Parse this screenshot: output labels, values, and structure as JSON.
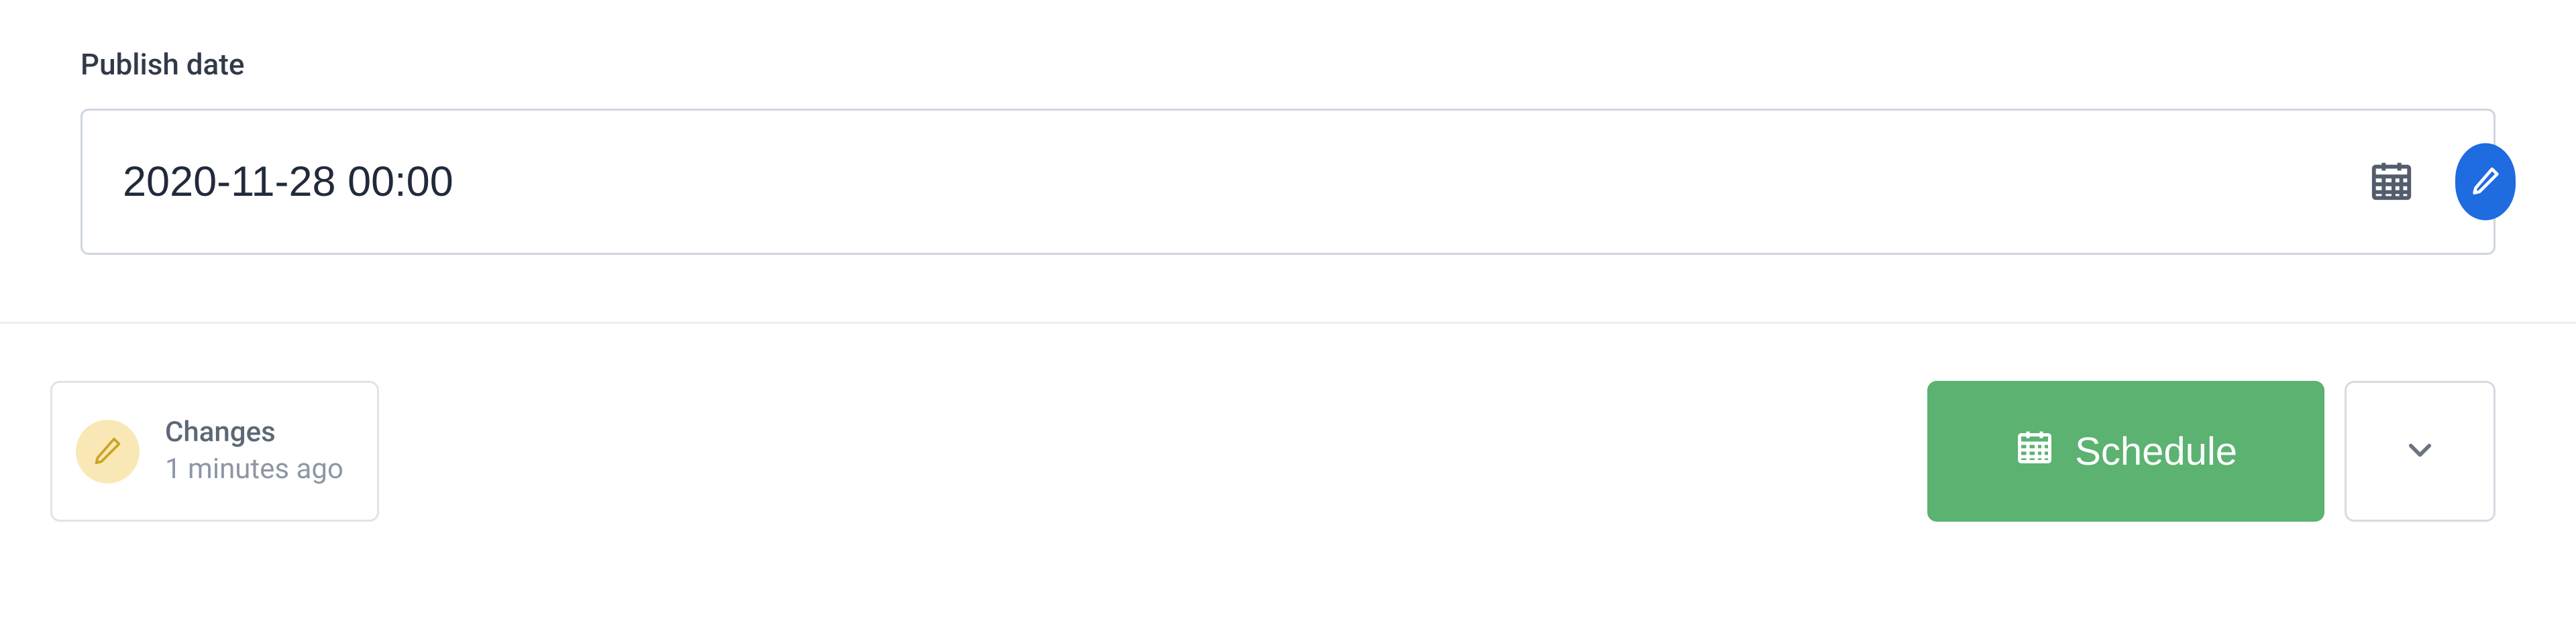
{
  "field": {
    "label": "Publish date",
    "value": "2020-11-28 00:00"
  },
  "changes": {
    "title": "Changes",
    "time": "1 minutes ago"
  },
  "actions": {
    "schedule_label": "Schedule"
  }
}
